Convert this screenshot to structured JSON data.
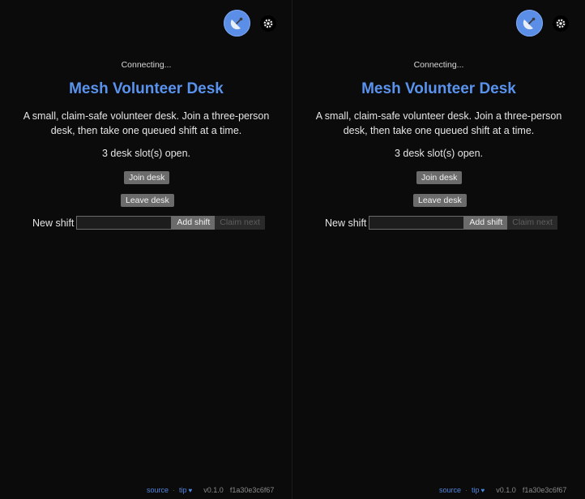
{
  "panes": [
    {
      "status": "Connecting...",
      "title": "Mesh Volunteer Desk",
      "description": "A small, claim-safe volunteer desk. Join a three-person desk, then take one queued shift at a time.",
      "slots_text": "3 desk slot(s) open.",
      "join_label": "Join desk",
      "leave_label": "Leave desk",
      "shift_label": "New shift",
      "shift_value": "",
      "add_label": "Add shift",
      "claim_label": "Claim next",
      "footer": {
        "source": "source",
        "tip": "tip",
        "heart": "♥",
        "version": "v0.1.0",
        "hash": "f1a30e3c6f67"
      }
    },
    {
      "status": "Connecting...",
      "title": "Mesh Volunteer Desk",
      "description": "A small, claim-safe volunteer desk. Join a three-person desk, then take one queued shift at a time.",
      "slots_text": "3 desk slot(s) open.",
      "join_label": "Join desk",
      "leave_label": "Leave desk",
      "shift_label": "New shift",
      "shift_value": "",
      "add_label": "Add shift",
      "claim_label": "Claim next",
      "footer": {
        "source": "source",
        "tip": "tip",
        "heart": "♥",
        "version": "v0.1.0",
        "hash": "f1a30e3c6f67"
      }
    }
  ],
  "icons": {
    "avatar": "satellite-dish-icon",
    "settings": "gear-icon",
    "heart": "heart-icon"
  },
  "colors": {
    "background": "#0b0b0b",
    "accent": "#5a93ee",
    "button": "#6b6b6b",
    "disabled_button": "#2a2a2a"
  }
}
